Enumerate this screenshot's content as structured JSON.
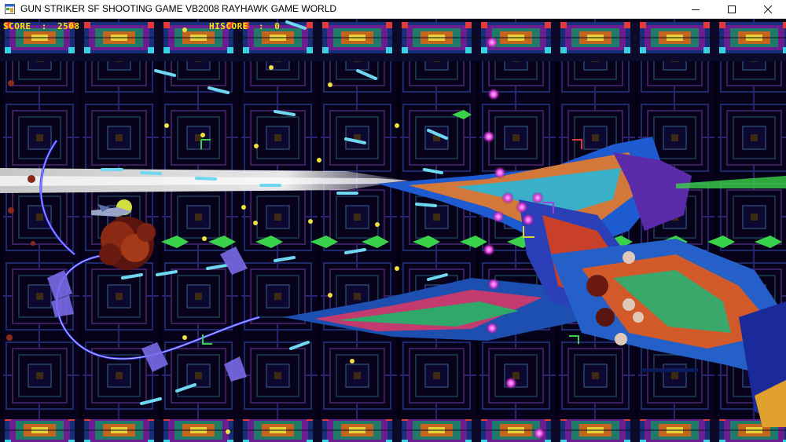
{
  "window": {
    "title": "GUN STRIKER SF SHOOTING GAME VB2008 RAYHAWK GAME WORLD",
    "buttons": [
      "minimize",
      "maximize",
      "close"
    ]
  },
  "hud": {
    "score_label": "SCORE",
    "score_value": "2508",
    "hiscore_label": "HISCORE",
    "hiscore_value": "0"
  },
  "colors": {
    "hud_text": "#ffe600",
    "background": "#07021a",
    "laser": "#e8e8e8",
    "plasma_orb": "#e040e0",
    "boss_primary": "#2a7fe0"
  },
  "icons": [
    "app-icon",
    "minimize-icon",
    "maximize-icon",
    "close-icon"
  ]
}
